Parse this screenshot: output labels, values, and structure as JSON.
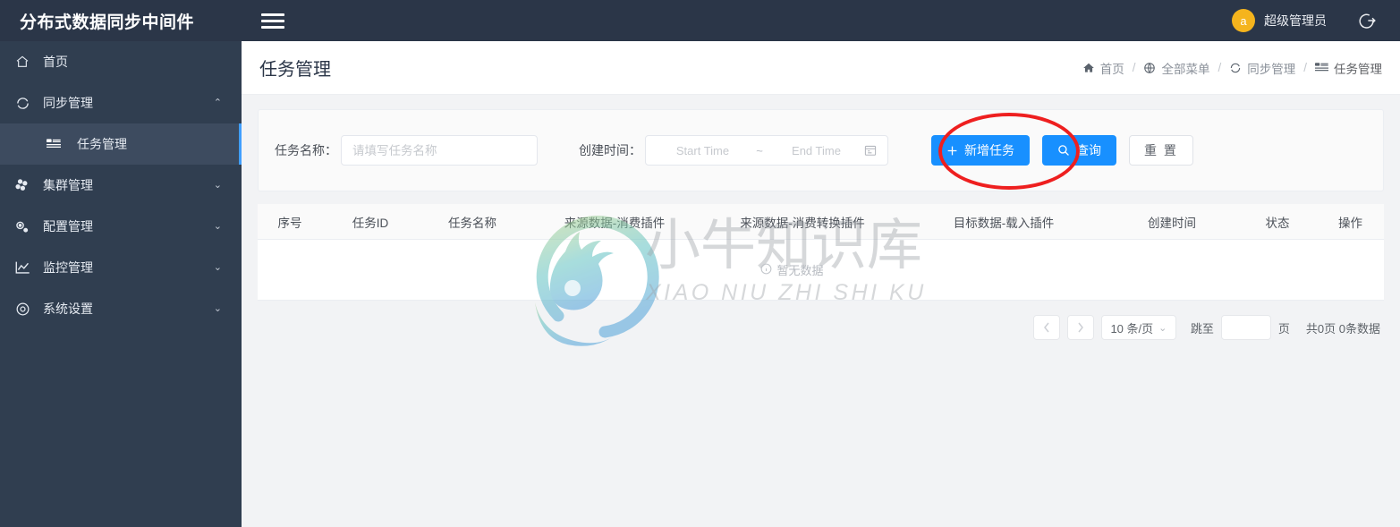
{
  "topbar": {
    "brand": "分布式数据同步中间件",
    "menu_toggle_icon": "hamburger-icon",
    "avatar_letter": "a",
    "user_name": "超级管理员",
    "logout_icon": "logout-icon",
    "bg_color": "#2b3648"
  },
  "sidebar": {
    "bg_color": "#303e50",
    "active_accent": "#409eff",
    "items": [
      {
        "label": "首页",
        "icon": "home-icon",
        "arrow": "",
        "active": false
      },
      {
        "label": "同步管理",
        "icon": "sync-icon",
        "arrow": "⌃",
        "active": false,
        "children": [
          {
            "label": "任务管理",
            "icon": "task-list-icon",
            "active": true
          }
        ]
      },
      {
        "label": "集群管理",
        "icon": "cubes-icon",
        "arrow": "⌄",
        "active": false
      },
      {
        "label": "配置管理",
        "icon": "gears-icon",
        "arrow": "⌄",
        "active": false
      },
      {
        "label": "监控管理",
        "icon": "chart-icon",
        "arrow": "⌄",
        "active": false
      },
      {
        "label": "系统设置",
        "icon": "settings-circle-icon",
        "arrow": "⌄",
        "active": false
      }
    ]
  },
  "page": {
    "title": "任务管理",
    "breadcrumb": [
      {
        "label": "首页",
        "icon": "home-solid-icon"
      },
      {
        "label": "全部菜单",
        "icon": "globe-icon"
      },
      {
        "label": "同步管理",
        "icon": "sync-icon"
      },
      {
        "label": "任务管理",
        "icon": "task-list-icon"
      }
    ],
    "breadcrumb_separator": "/"
  },
  "search": {
    "task_name_label": "任务名称：",
    "task_name_value": "",
    "task_name_placeholder": "请填写任务名称",
    "create_time_label": "创建时间：",
    "start_time_placeholder": "Start Time",
    "range_separator": "~",
    "end_time_placeholder": "End Time",
    "calendar_icon": "calendar-icon",
    "buttons": {
      "add_label": "新增任务",
      "add_icon": "plus-icon",
      "query_label": "查询",
      "query_icon": "search-icon",
      "reset_label": "重 置"
    },
    "primary_color": "#1890ff"
  },
  "table": {
    "columns": [
      "序号",
      "任务ID",
      "任务名称",
      "来源数据-消费插件",
      "来源数据-消费转换插件",
      "目标数据-载入插件",
      "创建时间",
      "状态",
      "操作"
    ],
    "rows": [],
    "empty_text": "暂无数据",
    "empty_icon": "info-circle-icon"
  },
  "pagination": {
    "prev_icon": "chevron-left-icon",
    "next_icon": "chevron-right-icon",
    "page_size_label": "10 条/页",
    "page_size_caret": "⌄",
    "jump_label": "跳至",
    "jump_value": "",
    "page_unit": "页",
    "total_text": "共0页 0条数据"
  },
  "watermark": {
    "title": "小牛知识库",
    "subtitle": "XIAO NIU ZHI SHI KU"
  },
  "annotation": {
    "shape": "ellipse",
    "color": "#ee1f1f",
    "target": "新增任务"
  }
}
